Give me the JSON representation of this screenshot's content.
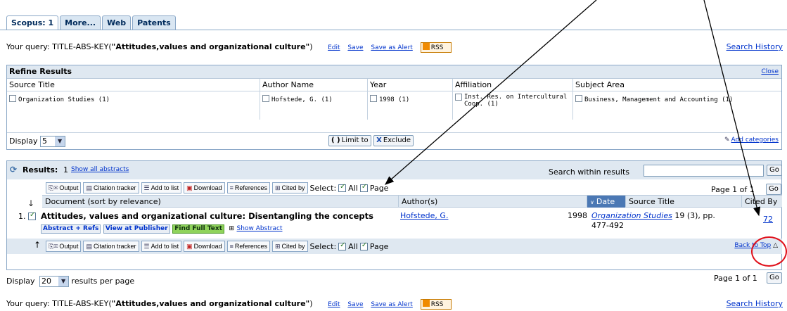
{
  "tabs": [
    "Scopus: 1",
    "More...",
    "Web",
    "Patents"
  ],
  "query": {
    "prefix": "Your query: TITLE-ABS-KEY(",
    "term": "\"Attitudes,values and organizational culture\"",
    "suffix": ")",
    "links": [
      "Edit",
      "Save",
      "Save as Alert"
    ],
    "rss": "RSS",
    "history": "Search History"
  },
  "refine": {
    "title": "Refine Results",
    "close": "Close",
    "columns": [
      "Source Title",
      "Author Name",
      "Year",
      "Affiliation",
      "Subject Area"
    ],
    "values": [
      "Organization Studies (1)",
      "Hofstede, G. (1)",
      "1998 (1)",
      "Inst. Res. on Intercultural Coop. (1)",
      "Business, Management and Accounting (1)"
    ],
    "display_label": "Display",
    "display_value": "5",
    "limit_to": "Limit to",
    "exclude": "Exclude",
    "add_categories": "Add categories"
  },
  "results": {
    "label": "Results:",
    "count": "1",
    "show_all": "Show all abstracts",
    "search_within": "Search within results",
    "go": "Go",
    "toolbar": [
      "Output",
      "Citation tracker",
      "Add to list",
      "Download",
      "References",
      "Cited by"
    ],
    "select_label": "Select:",
    "select_all": "All",
    "select_page": "Page",
    "page_info_prefix": "Page 1 of",
    "page_info_last": "1",
    "page_info_full": "Page 1 of 1",
    "columns": {
      "document": "Document (sort by relevance)",
      "authors": "Author(s)",
      "date": "Date",
      "source": "Source Title",
      "cited": "Cited By"
    },
    "row": {
      "num": "1.",
      "title": "Attitudes, values and organizational culture: Disentangling the concepts",
      "abstract_refs": "Abstract + Refs",
      "view_publisher": "View at Publisher",
      "find_full_text": "Find Full Text",
      "show_abstract": "Show Abstract",
      "author": "Hofstede, G.",
      "year": "1998",
      "source_journal": "Organization Studies",
      "source_rest": "19 (3), pp.",
      "source_pages": "477-492",
      "cited": "72"
    },
    "back_to_top": "Back to Top",
    "display_label": "Display",
    "display_value": "20",
    "results_per_page": "results per page"
  }
}
